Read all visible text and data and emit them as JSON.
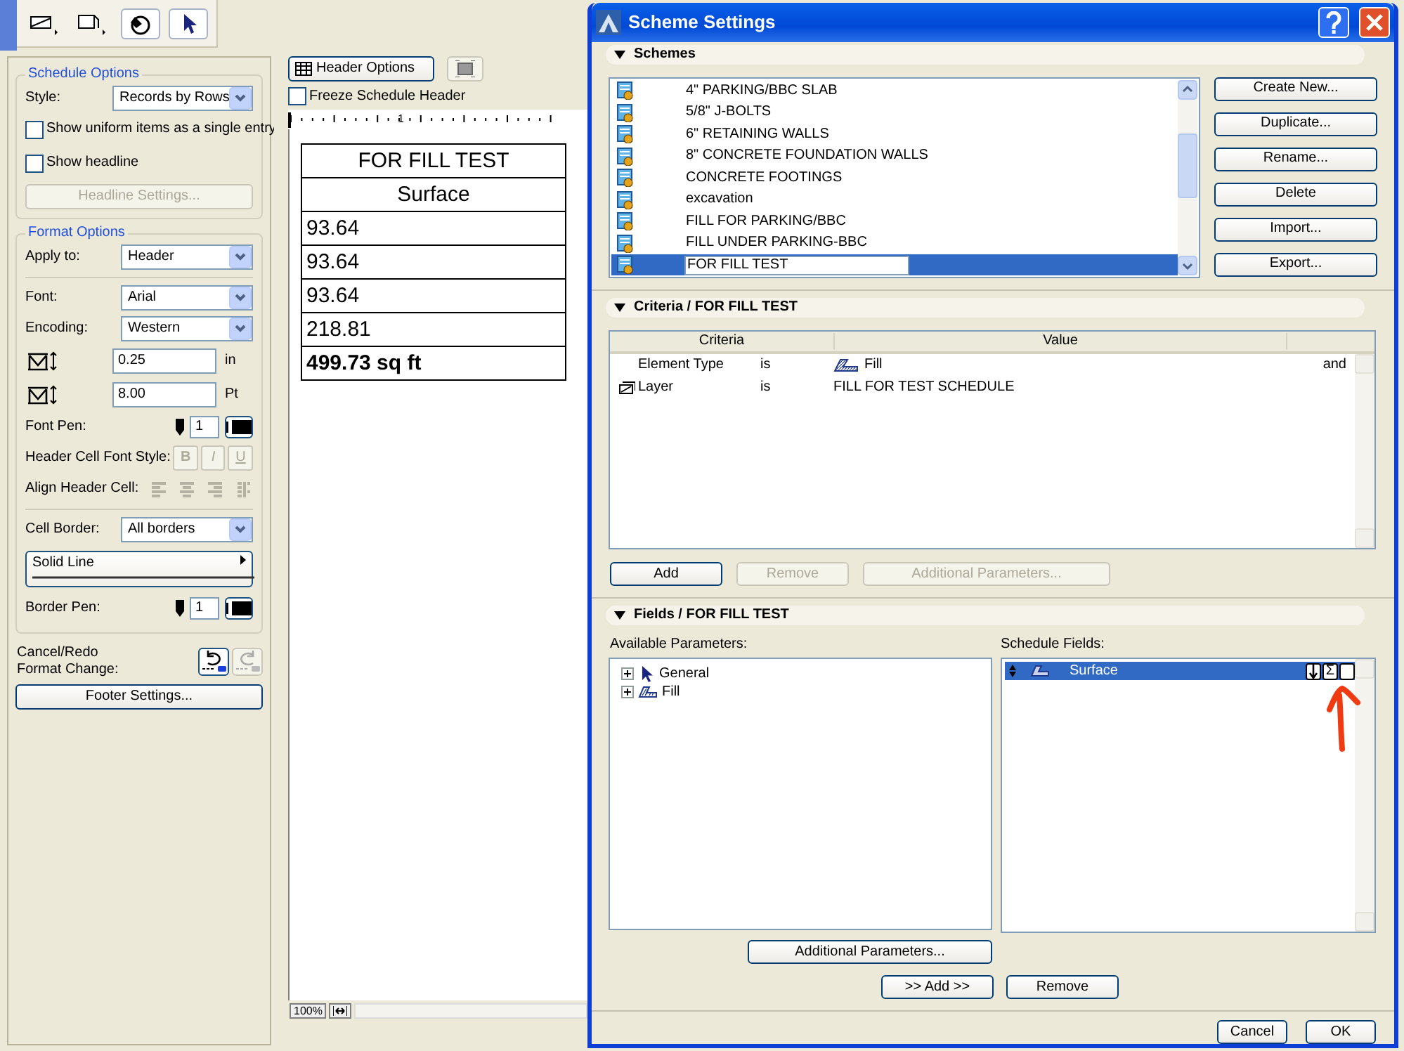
{
  "toolbar": {
    "tools": [
      {
        "kind": "wall",
        "selected": false
      },
      {
        "kind": "shape",
        "selected": false
      },
      {
        "kind": "fill",
        "selected": true
      },
      {
        "kind": "arrow",
        "selected": true
      }
    ]
  },
  "schedule_options": {
    "title": "Schedule Options",
    "style_label": "Style:",
    "style_value": "Records by Rows",
    "checkboxes": [
      {
        "label": "Show uniform items as a single entry",
        "checked": false
      },
      {
        "label": "Show headline",
        "checked": false
      }
    ],
    "headline_button": {
      "label": "Headline Settings...",
      "disabled": true
    }
  },
  "format_options": {
    "title": "Format Options",
    "apply_to": {
      "label": "Apply to:",
      "value": "Header"
    },
    "font": {
      "label": "Font:",
      "value": "Arial"
    },
    "encoding": {
      "label": "Encoding:",
      "value": "Western"
    },
    "size": {
      "value": "0.25",
      "unit": "in"
    },
    "spacing": {
      "value": "8.00",
      "unit": "Pt"
    },
    "font_pen": {
      "label": "Font Pen:",
      "value": "1"
    },
    "font_style": {
      "label": "Header Cell Font Style:",
      "buttons": [
        {
          "kind": "bold",
          "label": "B",
          "disabled": true
        },
        {
          "kind": "italic",
          "label": "I",
          "disabled": true
        },
        {
          "kind": "underline",
          "label": "U",
          "disabled": true
        }
      ]
    },
    "align": {
      "label": "Align Header Cell:",
      "disabled": true
    },
    "cell_border": {
      "label": "Cell Border:",
      "value": "All borders"
    },
    "line_type": "Solid Line",
    "border_pen": {
      "label": "Border Pen:",
      "value": "1"
    }
  },
  "format_change": {
    "label_lines": [
      "Cancel/Redo",
      "Format Change:"
    ],
    "undo_disabled": false,
    "redo_disabled": true
  },
  "footer_button": "Footer Settings...",
  "schedule": {
    "header_options_button": "Header Options",
    "freeze": {
      "label": "Freeze Schedule Header",
      "checked": false
    },
    "ruler_label": "1",
    "title": "FOR FILL TEST",
    "column": "Surface",
    "rows": [
      "93.64",
      "93.64",
      "93.64",
      "218.81"
    ],
    "total": "499.73 sq ft",
    "zoom": "100%"
  },
  "dialog": {
    "title": "Scheme Settings",
    "schemes": {
      "title": "Schemes",
      "expanded": true,
      "items": [
        {
          "name": "4\" PARKING/BBC SLAB",
          "selected": false,
          "editing": false
        },
        {
          "name": "5/8\" J-BOLTS",
          "selected": false,
          "editing": false
        },
        {
          "name": "6\" RETAINING WALLS",
          "selected": false,
          "editing": false
        },
        {
          "name": "8\" CONCRETE FOUNDATION WALLS",
          "selected": false,
          "editing": false
        },
        {
          "name": "CONCRETE FOOTINGS",
          "selected": false,
          "editing": false
        },
        {
          "name": "excavation",
          "selected": false,
          "editing": false
        },
        {
          "name": "FILL FOR PARKING/BBC",
          "selected": false,
          "editing": false
        },
        {
          "name": "FILL UNDER PARKING-BBC",
          "selected": false,
          "editing": false
        },
        {
          "name": "FOR FILL TEST",
          "selected": true,
          "editing": true
        }
      ],
      "buttons": [
        "Create New...",
        "Duplicate...",
        "Rename...",
        "Delete",
        "Import...",
        "Export..."
      ]
    },
    "criteria": {
      "title": "Criteria /  FOR FILL TEST",
      "expanded": true,
      "columns": [
        "Criteria",
        "Value"
      ],
      "rows": [
        {
          "kind": "element",
          "criteria": "Element Type",
          "operator": "is",
          "value": "Fill",
          "conjunction": "and"
        },
        {
          "kind": "layer",
          "criteria": "Layer",
          "operator": "is",
          "value": "FILL FOR TEST SCHEDULE"
        }
      ],
      "buttons": [
        {
          "label": "Add",
          "disabled": false
        },
        {
          "label": "Remove",
          "disabled": true
        },
        {
          "label": "Additional Parameters...",
          "disabled": true
        }
      ]
    },
    "fields": {
      "title": "Fields /  FOR FILL TEST",
      "expanded": true,
      "available_label": "Available Parameters:",
      "available": [
        {
          "kind": "general",
          "label": "General",
          "expanded": false
        },
        {
          "kind": "fill",
          "label": "Fill",
          "expanded": false
        }
      ],
      "additional_button": "Additional Parameters...",
      "schedule_label": "Schedule Fields:",
      "schedule_fields": [
        {
          "label": "Surface",
          "selected": true,
          "sum_label": "Σ"
        }
      ],
      "add_button": ">> Add >>",
      "remove_button": "Remove"
    },
    "buttons": [
      "Cancel",
      "OK"
    ]
  }
}
